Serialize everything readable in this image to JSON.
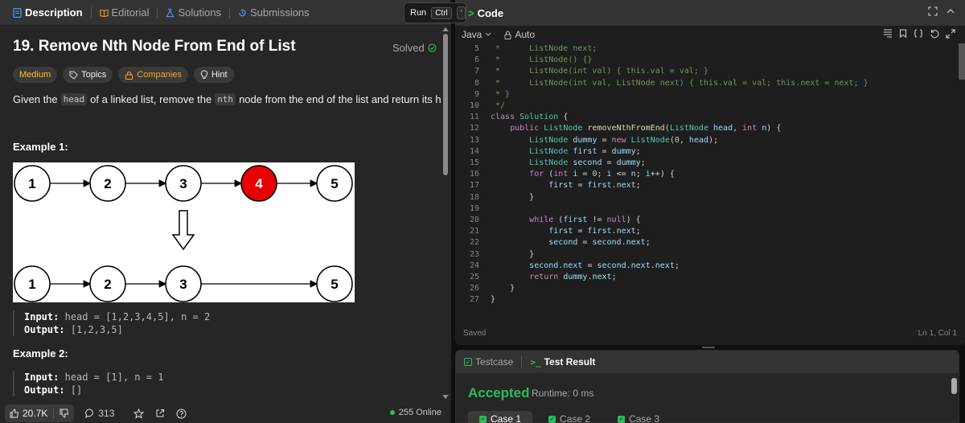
{
  "left_tabs": {
    "description": "Description",
    "editorial": "Editorial",
    "solutions": "Solutions",
    "submissions": "Submissions"
  },
  "run_popover": {
    "label": "Run",
    "key": "Ctrl",
    "key2": "'"
  },
  "problem": {
    "title": "19. Remove Nth Node From End of List",
    "status": "Solved",
    "difficulty": "Medium",
    "tags": [
      "Topics",
      "Companies",
      "Hint"
    ],
    "desc_part1": "Given the",
    "desc_code1": "head",
    "desc_part2": "of a linked list, remove the",
    "desc_code2": "nth",
    "desc_part3": "node from the end of the list and return its head.",
    "example1_title": "Example 1:",
    "example1_input_label": "Input:",
    "example1_input_value": "head = [1,2,3,4,5], n = 2",
    "example1_output_label": "Output:",
    "example1_output_value": "[1,2,3,5]",
    "example2_title": "Example 2:",
    "example2_input_label": "Input:",
    "example2_input_value": "head = [1], n = 1",
    "example2_output_label": "Output:",
    "example2_output_value": "[]",
    "diagram_top": [
      "1",
      "2",
      "3",
      "4",
      "5"
    ],
    "diagram_bottom": [
      "1",
      "2",
      "3",
      "5"
    ],
    "highlight_color": "#e60000"
  },
  "footer": {
    "likes": "20.7K",
    "comments": "313",
    "online": "255 Online"
  },
  "code_panel": {
    "title": "Code",
    "language": "Java",
    "mode": "Auto",
    "saved": "Saved",
    "cursor": "Ln 1, Col 1",
    "lines": [
      {
        "n": "5",
        "text": " *      ListNode next;"
      },
      {
        "n": "6",
        "text": " *      ListNode() {}"
      },
      {
        "n": "7",
        "text": " *      ListNode(int val) { this.val = val; }"
      },
      {
        "n": "8",
        "text": " *      ListNode(int val, ListNode next) { this.val = val; this.next = next; }"
      },
      {
        "n": "9",
        "text": " * }"
      },
      {
        "n": "10",
        "text": " */"
      },
      {
        "n": "11",
        "text": "class Solution {"
      },
      {
        "n": "12",
        "text": "    public ListNode removeNthFromEnd(ListNode head, int n) {"
      },
      {
        "n": "13",
        "text": "        ListNode dummy = new ListNode(0, head);"
      },
      {
        "n": "14",
        "text": "        ListNode first = dummy;"
      },
      {
        "n": "15",
        "text": "        ListNode second = dummy;"
      },
      {
        "n": "16",
        "text": "        for (int i = 0; i <= n; i++) {"
      },
      {
        "n": "17",
        "text": "            first = first.next;"
      },
      {
        "n": "18",
        "text": "        }"
      },
      {
        "n": "19",
        "text": ""
      },
      {
        "n": "20",
        "text": "        while (first != null) {"
      },
      {
        "n": "21",
        "text": "            first = first.next;"
      },
      {
        "n": "22",
        "text": "            second = second.next;"
      },
      {
        "n": "23",
        "text": "        }"
      },
      {
        "n": "24",
        "text": "        second.next = second.next.next;"
      },
      {
        "n": "25",
        "text": "        return dummy.next;"
      },
      {
        "n": "26",
        "text": "    }"
      },
      {
        "n": "27",
        "text": "}"
      }
    ]
  },
  "test_panel": {
    "tab_testcase": "Testcase",
    "tab_result": "Test Result",
    "result": "Accepted",
    "runtime": "Runtime: 0 ms",
    "cases": [
      "Case 1",
      "Case 2",
      "Case 3"
    ]
  },
  "colors": {
    "accent_green": "#2cbb5d",
    "medium": "#ffc01e",
    "brand_orange": "#ffa116"
  }
}
